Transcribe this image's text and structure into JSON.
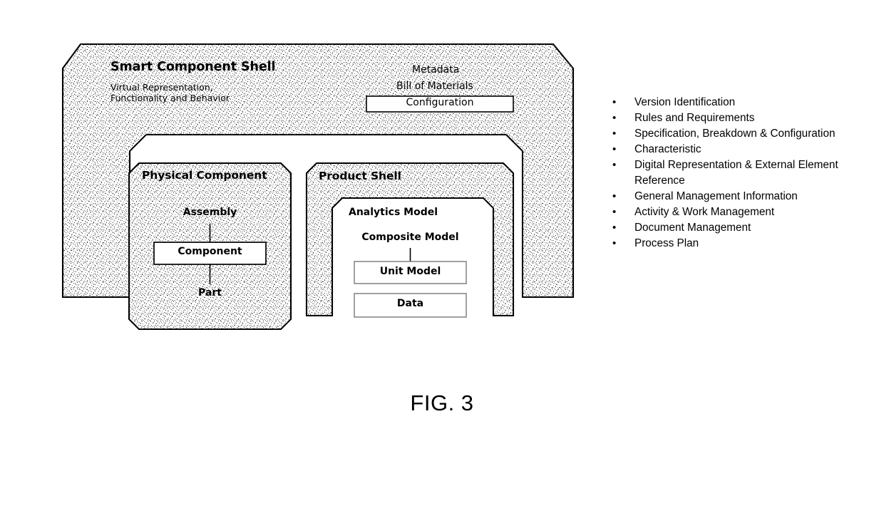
{
  "figure": {
    "caption": "FIG. 3"
  },
  "diagram": {
    "outer_shell": {
      "title": "Smart Component Shell",
      "subtitle_line1": "Virtual Representation,",
      "subtitle_line2": "Functionality and Behavior",
      "metadata_label": "Metadata",
      "bom_label": "Bill of Materials",
      "configuration_box": "Configuration"
    },
    "physical_component": {
      "title": "Physical Component",
      "assembly_label": "Assembly",
      "component_box": "Component",
      "part_label": "Part"
    },
    "product_shell": {
      "title": "Product Shell",
      "analytics_model_label": "Analytics Model",
      "composite_model_label": "Composite Model",
      "unit_model_box": "Unit Model",
      "data_box": "Data"
    }
  },
  "bullets": [
    "Version Identification",
    "Rules and Requirements",
    "Specification, Breakdown & Configuration",
    "Characteristic",
    "Digital Representation & External Element Reference",
    "General Management Information",
    "Activity & Work Management",
    "Document Management",
    "Process Plan"
  ],
  "colors": {
    "stroke": "#000000",
    "fill_white": "#ffffff",
    "stipple_dot": "#4d4d4d",
    "stipple_bg": "#ffffff"
  }
}
